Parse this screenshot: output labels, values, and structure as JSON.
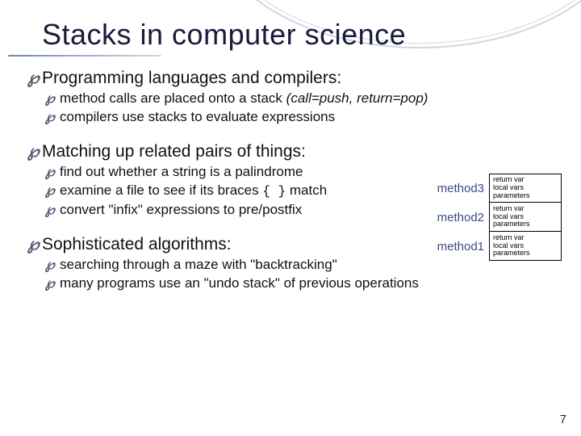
{
  "title": "Stacks in computer science",
  "sections": [
    {
      "heading": "Programming languages and compilers:",
      "items": [
        {
          "pre": "method calls are placed onto a stack ",
          "ital": "(call=push, return=pop)"
        },
        {
          "pre": "compilers use stacks to evaluate expressions"
        }
      ]
    },
    {
      "heading": "Matching up related pairs of things:",
      "items": [
        {
          "pre": "find out whether a string is a palindrome"
        },
        {
          "pre": "examine a file to see if its braces ",
          "code": "{ }",
          "post": " match"
        },
        {
          "pre": "convert \"infix\" expressions to pre/postfix"
        }
      ]
    },
    {
      "heading": "Sophisticated algorithms:",
      "items": [
        {
          "pre": "searching through a maze with \"backtracking\""
        },
        {
          "pre": "many programs use an \"undo stack\" of previous operations"
        }
      ]
    }
  ],
  "stack": [
    {
      "label": "method3",
      "l1": "return var",
      "l2": "local vars",
      "l3": "parameters"
    },
    {
      "label": "method2",
      "l1": "return var",
      "l2": "local vars",
      "l3": "parameters"
    },
    {
      "label": "method1",
      "l1": "return var",
      "l2": "local vars",
      "l3": "parameters"
    }
  ],
  "bullet_glyph": "℘",
  "page_number": "7"
}
